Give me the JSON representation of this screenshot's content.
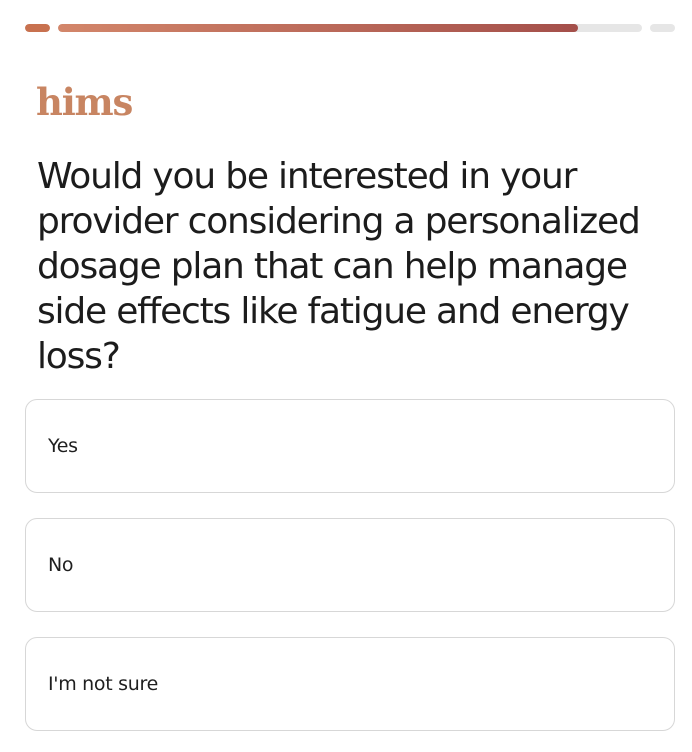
{
  "progress": {
    "segments": [
      {
        "fraction": 1.0
      },
      {
        "fraction": 0.89
      },
      {
        "fraction": 0.0
      }
    ],
    "fill_start_color": "#d3866a",
    "fill_end_color": "#a44f4a"
  },
  "brand": {
    "logo_text": "hims",
    "color": "#c88562"
  },
  "question": {
    "text": "Would you be interested in your provider considering a personalized dosage plan that can help manage side effects like fatigue and energy loss?"
  },
  "options": [
    {
      "label": "Yes"
    },
    {
      "label": "No"
    },
    {
      "label": "I'm not sure"
    }
  ]
}
